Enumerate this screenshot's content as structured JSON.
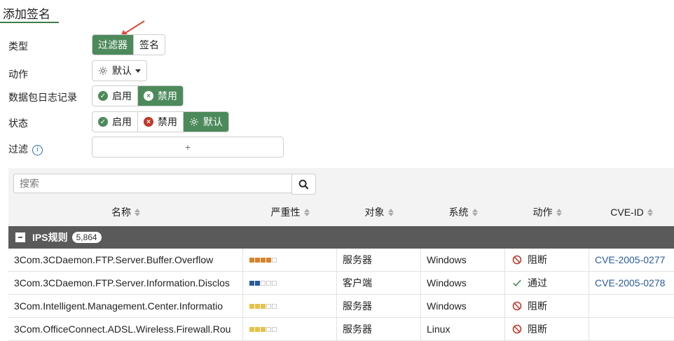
{
  "header": {
    "title": "添加签名"
  },
  "form": {
    "type": {
      "label": "类型",
      "options": [
        "过滤器",
        "签名"
      ],
      "active": "过滤器"
    },
    "action": {
      "label": "动作",
      "value": "默认"
    },
    "packet_log": {
      "label": "数据包日志记录",
      "options": [
        "启用",
        "禁用"
      ],
      "active": "禁用"
    },
    "status": {
      "label": "状态",
      "options": [
        "启用",
        "禁用",
        "默认"
      ],
      "active": "默认"
    },
    "filter": {
      "label": "过滤",
      "add": "+"
    }
  },
  "table": {
    "search_placeholder": "搜索",
    "columns": [
      "名称",
      "严重性",
      "对象",
      "系统",
      "动作",
      "CVE-ID"
    ],
    "group": {
      "label": "IPS规则",
      "count": "5,864"
    },
    "rows": [
      {
        "name": "3Com.3CDaemon.FTP.Server.Buffer.Overflow",
        "severity": 4,
        "severity_color": "#d9822b",
        "target": "服务器",
        "os": "Windows",
        "action": "阻断",
        "action_type": "block",
        "cve": "CVE-2005-0277"
      },
      {
        "name": "3Com.3CDaemon.FTP.Server.Information.Disclos",
        "severity": 2,
        "severity_color": "#2a5b9c",
        "target": "客户端",
        "os": "Windows",
        "action": "通过",
        "action_type": "pass",
        "cve": "CVE-2005-0278"
      },
      {
        "name": "3Com.Intelligent.Management.Center.Informatio",
        "severity": 3,
        "severity_color": "#e6c24a",
        "target": "服务器",
        "os": "Windows",
        "action": "阻断",
        "action_type": "block",
        "cve": ""
      },
      {
        "name": "3Com.OfficeConnect.ADSL.Wireless.Firewall.Rou",
        "severity": 3,
        "severity_color": "#e6c24a",
        "target": "服务器",
        "os": "Linux",
        "action": "阻断",
        "action_type": "block",
        "cve": ""
      }
    ]
  },
  "colors": {
    "accent": "#4d8a5b",
    "annotation_arrow": "#e2473a",
    "link": "#2a5b9c",
    "block": "#c0392b"
  }
}
